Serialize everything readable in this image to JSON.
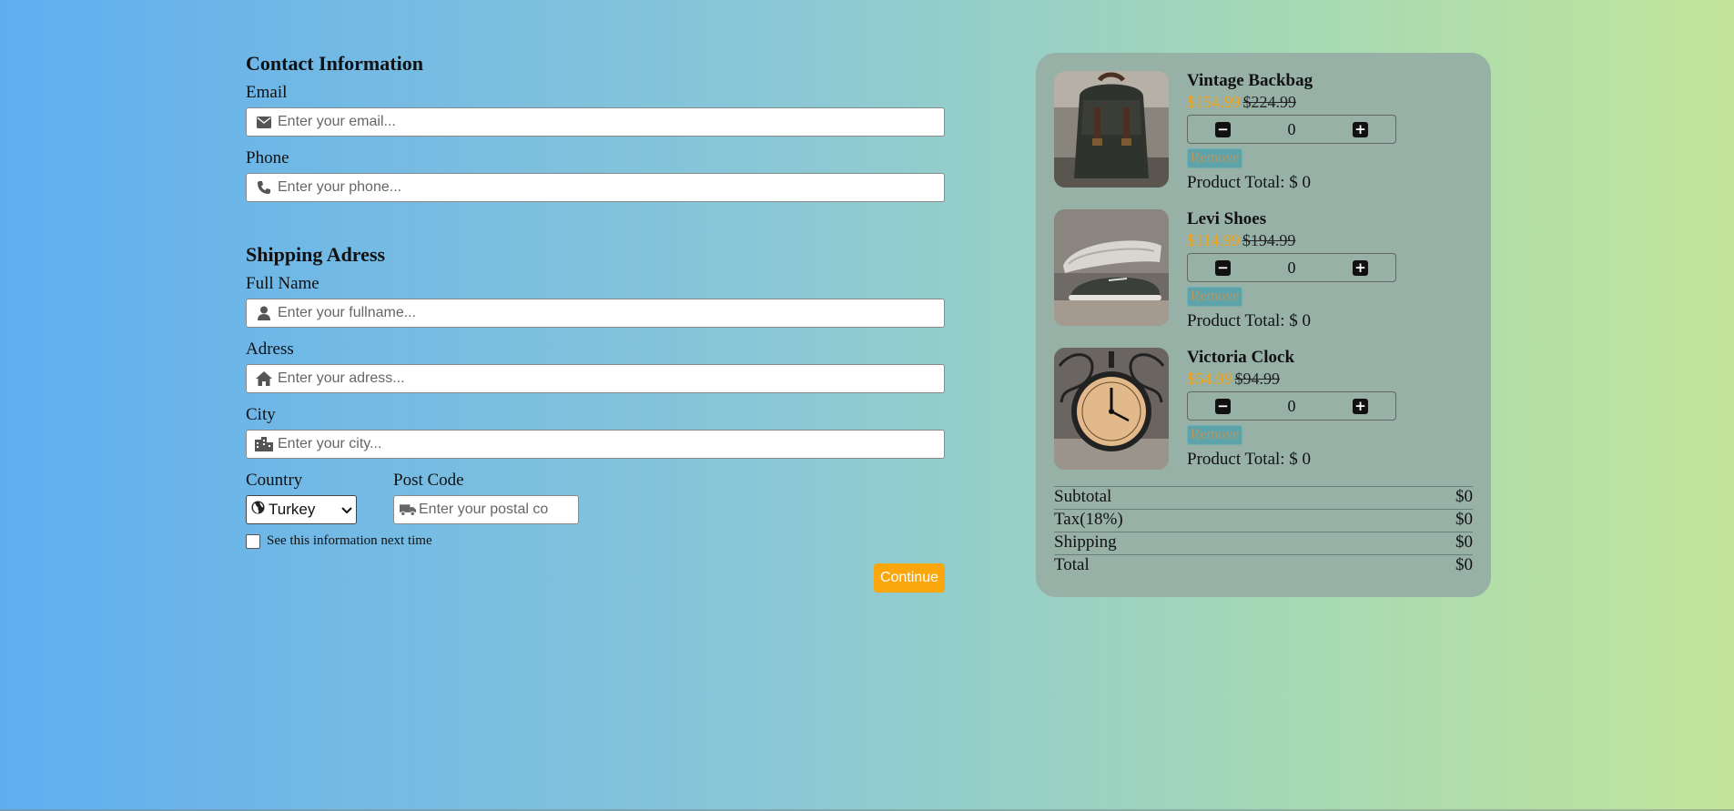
{
  "contact": {
    "title": "Contact Information",
    "email_label": "Email",
    "email_placeholder": "Enter your email...",
    "phone_label": "Phone",
    "phone_placeholder": "Enter your phone..."
  },
  "shipping": {
    "title": "Shipping Adress",
    "fullname_label": "Full Name",
    "fullname_placeholder": "Enter your fullname...",
    "address_label": "Adress",
    "address_placeholder": "Enter your adress...",
    "city_label": "City",
    "city_placeholder": "Enter your city...",
    "country_label": "Country",
    "country_value": "Turkey",
    "postcode_label": "Post Code",
    "postcode_placeholder": "Enter your postal co",
    "remember_label": "See this information next time"
  },
  "continue_label": "Continue",
  "cart": {
    "items": [
      {
        "name": "Vintage Backbag",
        "price": "$154.99",
        "old_price": "$224.99",
        "qty": "0",
        "remove": "Remove",
        "total": "Product Total: $ 0"
      },
      {
        "name": "Levi Shoes",
        "price": "$114.99",
        "old_price": "$194.99",
        "qty": "0",
        "remove": "Remove",
        "total": "Product Total: $ 0"
      },
      {
        "name": "Victoria Clock",
        "price": "$54.99",
        "old_price": "$94.99",
        "qty": "0",
        "remove": "Remove",
        "total": "Product Total: $ 0"
      }
    ],
    "summary": {
      "subtotal_label": "Subtotal",
      "subtotal": "$0",
      "tax_label": "Tax(18%)",
      "tax": "$0",
      "shipping_label": "Shipping",
      "shipping": "$0",
      "total_label": "Total",
      "total": "$0"
    }
  },
  "colors": {
    "accent": "#f9a70c",
    "cart_bg": "#97b1a7"
  },
  "icons": [
    "envelope-icon",
    "phone-icon",
    "user-icon",
    "home-icon",
    "city-icon",
    "globe-icon",
    "truck-icon",
    "minus-icon",
    "plus-icon"
  ]
}
